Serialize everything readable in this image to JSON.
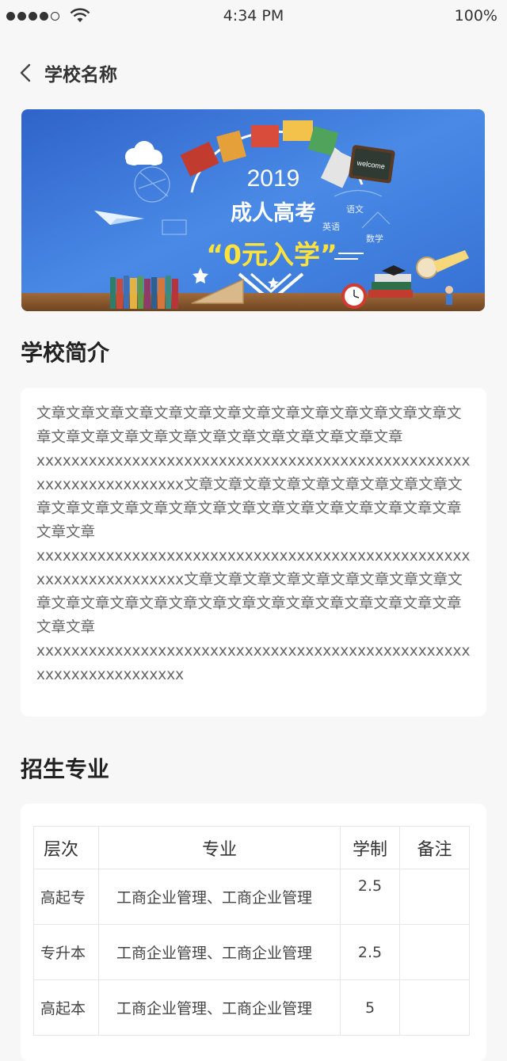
{
  "status_bar": {
    "time": "4:34 PM",
    "battery": "100%"
  },
  "nav": {
    "title": "学校名称"
  },
  "banner": {
    "year": "2019",
    "line1": "成人高考",
    "slogan": "“0元入学”",
    "board_text": "welcome",
    "book_words": [
      "语文",
      "英语",
      "数学"
    ]
  },
  "intro": {
    "title": "学校简介",
    "paragraphs": [
      "文章文章文章文章文章文章文章文章文章文章文章文章文章文章文章文章文章文章文章文章文章文章文章文章文章文章文章",
      "xxxxxxxxxxxxxxxxxxxxxxxxxxxxxxxxxxxxxxxxxxxxxxxxxxxxxxxxxxxxxxxxxxx文章文章文章文章文章文章文章文章文章文章文章文章文章文章文章文章文章文章文章文章文章文章文章文章文章文章",
      "xxxxxxxxxxxxxxxxxxxxxxxxxxxxxxxxxxxxxxxxxxxxxxxxxxxxxxxxxxxxxxxxxxx文章文章文章文章文章文章文章文章文章文章文章文章文章文章文章文章文章文章文章文章文章文章文章文章文章文章",
      "xxxxxxxxxxxxxxxxxxxxxxxxxxxxxxxxxxxxxxxxxxxxxxxxxxxxxxxxxxxxxxxxxxx"
    ]
  },
  "majors": {
    "title": "招生专业",
    "headers": [
      "层次",
      "专业",
      "学制",
      "备注"
    ],
    "rows": [
      {
        "level": "高起专",
        "major": "工商企业管理、工商企业管理",
        "years": "2.5",
        "note": ""
      },
      {
        "level": "专升本",
        "major": "工商企业管理、工商企业管理",
        "years": "2.5",
        "note": ""
      },
      {
        "level": "高起本",
        "major": "工商企业管理、工商企业管理",
        "years": "5",
        "note": ""
      }
    ]
  },
  "colors": {
    "background": "#f7f7f7",
    "banner_blue": "#3b77d6",
    "slogan_yellow": "#ffe23a",
    "text_dark": "#333333",
    "text_gray": "#666666"
  }
}
